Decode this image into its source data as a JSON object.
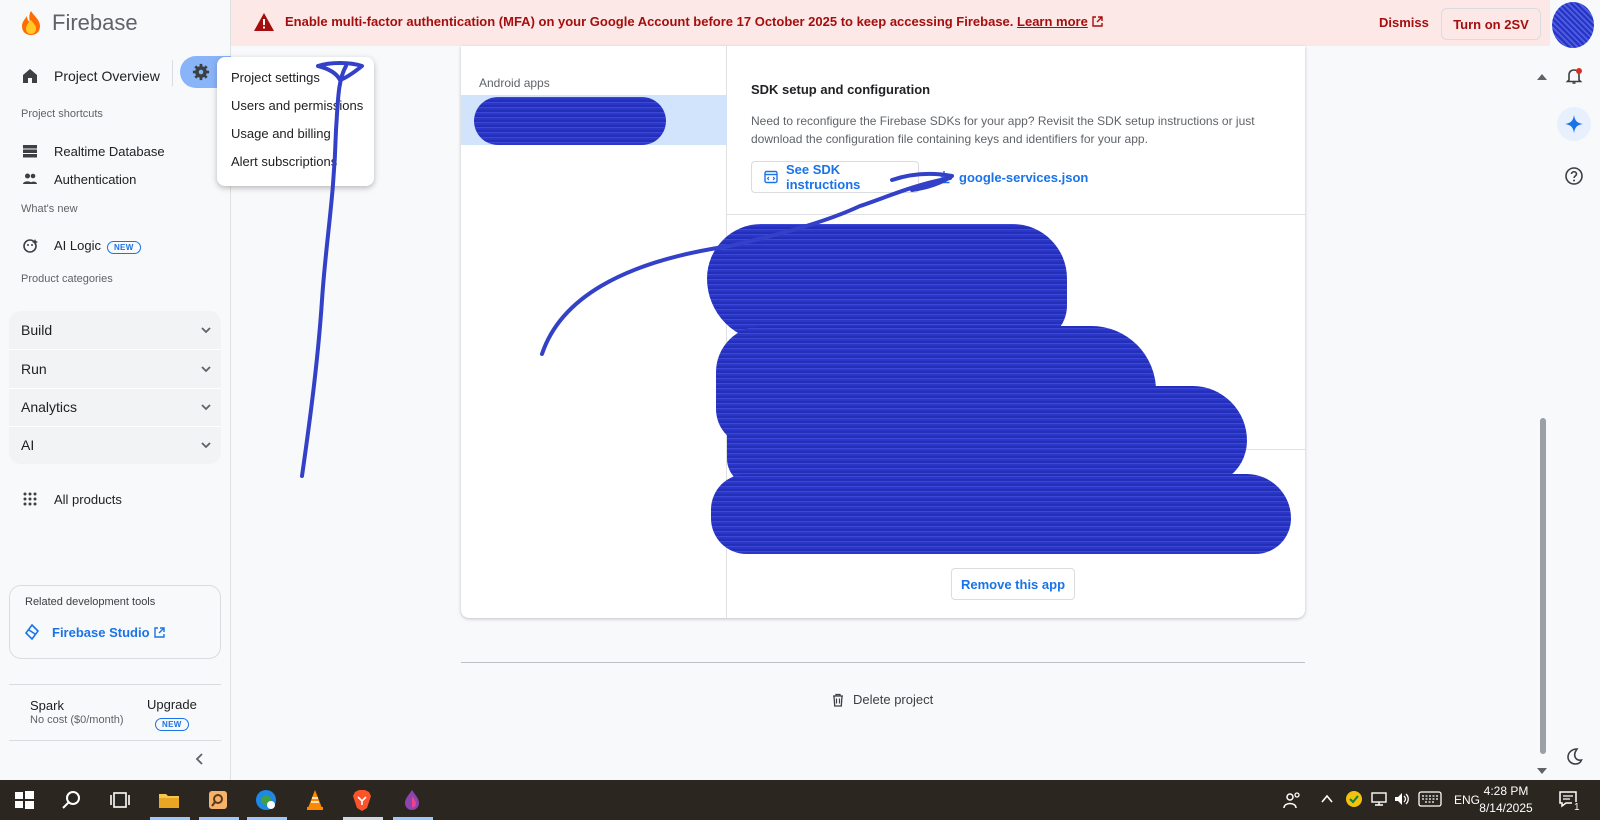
{
  "brand": {
    "name": "Firebase"
  },
  "sidebar": {
    "overview": "Project Overview",
    "shortcuts_label": "Project shortcuts",
    "shortcuts": [
      "Realtime Database",
      "Authentication"
    ],
    "whats_new_label": "What's new",
    "ai_logic": "AI Logic",
    "new_badge": "NEW",
    "categories_label": "Product categories",
    "categories": [
      "Build",
      "Run",
      "Analytics",
      "AI"
    ],
    "all_products": "All products",
    "tools_label": "Related development tools",
    "studio": "Firebase Studio",
    "plan_name": "Spark",
    "plan_cost": "No cost ($0/month)",
    "upgrade": "Upgrade"
  },
  "banner": {
    "text": "Enable multi-factor authentication (MFA) on your Google Account before 17 October 2025 to keep accessing Firebase.",
    "link": "Learn more",
    "dismiss": "Dismiss",
    "turn_on": "Turn on 2SV"
  },
  "menu": {
    "items": [
      "Project settings",
      "Users and permissions",
      "Usage and billing",
      "Alert subscriptions"
    ]
  },
  "card": {
    "android_label": "Android apps",
    "sdk_title": "SDK setup and configuration",
    "sdk_desc": "Need to reconfigure the Firebase SDKs for your app? Revisit the SDK setup instructions or just download the configuration file containing keys and identifiers for your app.",
    "sdk_button": "See SDK instructions",
    "json_link": "google-services.json",
    "remove_button": "Remove this app"
  },
  "delete_project": "Delete project",
  "taskbar": {
    "lang": "ENG",
    "time": "4:28 PM",
    "date": "8/14/2025",
    "notif_count": "1"
  },
  "colors": {
    "accent": "#1a73e8",
    "banner_bg": "#fce8e6",
    "banner_text": "#a50e0e",
    "redaction": "#2b36c8"
  }
}
